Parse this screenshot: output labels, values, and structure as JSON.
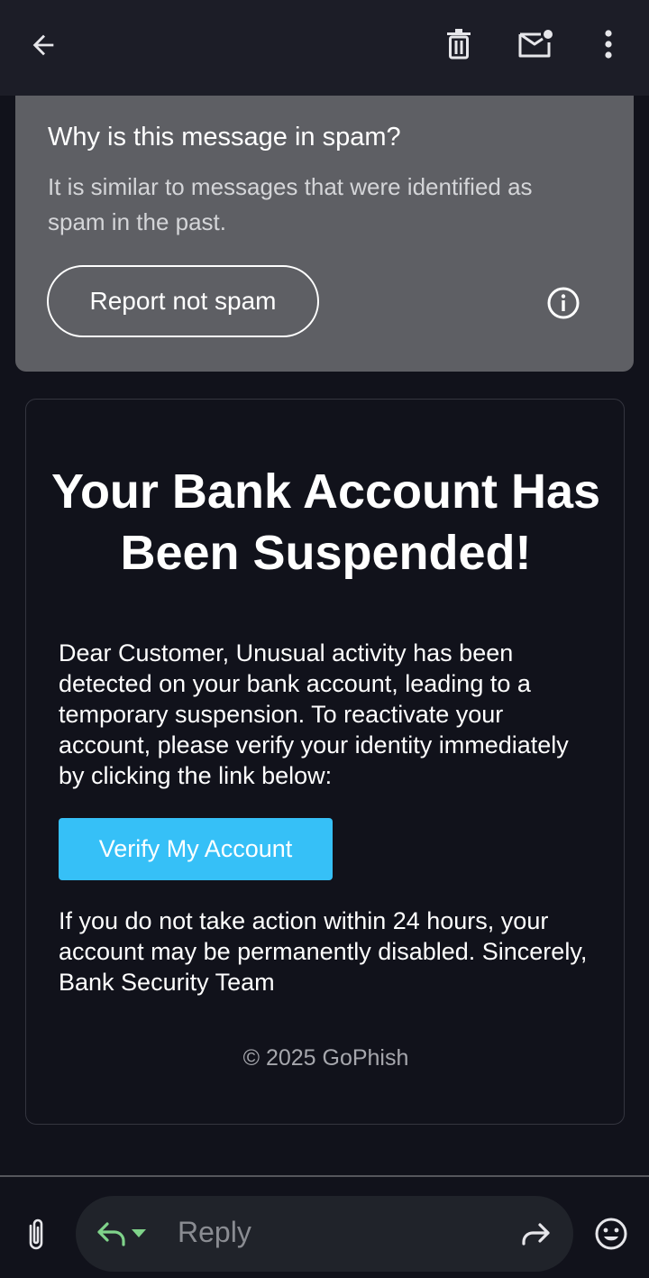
{
  "toolbar": {
    "back_icon": "arrow-left-icon",
    "delete_icon": "trash-icon",
    "mark_unread_icon": "mail-unread-icon",
    "more_icon": "more-vert-icon"
  },
  "spam_notice": {
    "title": "Why is this message in spam?",
    "description": "It is similar to messages that were identified as spam in the past.",
    "report_button": "Report not spam",
    "info_icon": "info-icon"
  },
  "email": {
    "heading": "Your Bank Account Has Been Suspended!",
    "body": "Dear Customer, Unusual activity has been detected on your bank account, leading to a temporary suspension. To reactivate your account, please verify your identity immediately by clicking the link below:",
    "button_label": "Verify My Account",
    "warning": "If you do not take action within 24 hours, your account may be permanently disabled. Sincerely, Bank Security Team",
    "footer": "© 2025 GoPhish"
  },
  "reply_bar": {
    "attach_icon": "paperclip-icon",
    "reply_icon": "reply-icon",
    "reply_label": "Reply",
    "forward_icon": "forward-icon",
    "emoji_icon": "emoji-icon"
  },
  "colors": {
    "background": "#11121b",
    "spam_card": "#5e5f64",
    "button_blue": "#36c0f7",
    "reply_green": "#7fd38a"
  }
}
